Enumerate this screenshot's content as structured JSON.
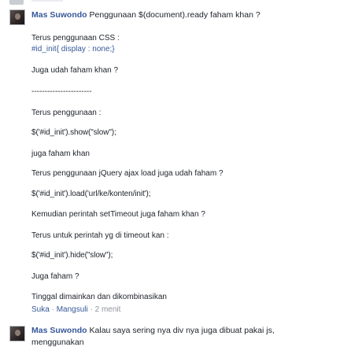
{
  "comments": [
    {
      "author": "Mas Suwondo",
      "text": "Penggunaan $(document).ready faham khan ?",
      "body": [
        "Terus penggunaan CSS :",
        "#id_init{ display : none;}",
        "Juga udah faham khan ?",
        "-----------------------",
        "Terus penggunaan :",
        "$('#id_init').show(\"slow\");",
        "juga faham khan",
        "Terus penggunaan jQuery ajax load juga udah faham ?",
        "$('#id_init').load('url/ke/konten/init');",
        "Kemudian perintah setTimeout juga faham khan ?",
        "Terus untuk perintah yg di timeout kan :",
        "$('#id_init').hide(\"slow\");",
        "Juga faham ?",
        "Tinggal dimainkan dan dikombinasikan"
      ],
      "actions": {
        "like": "Suka",
        "reply": "Mangsuli",
        "time": "2 menit"
      }
    },
    {
      "author": "Mas Suwondo",
      "text": "Kalau saya sering nya div nya juga dibuat pakai js,",
      "text_line2": "menggunakan"
    }
  ]
}
